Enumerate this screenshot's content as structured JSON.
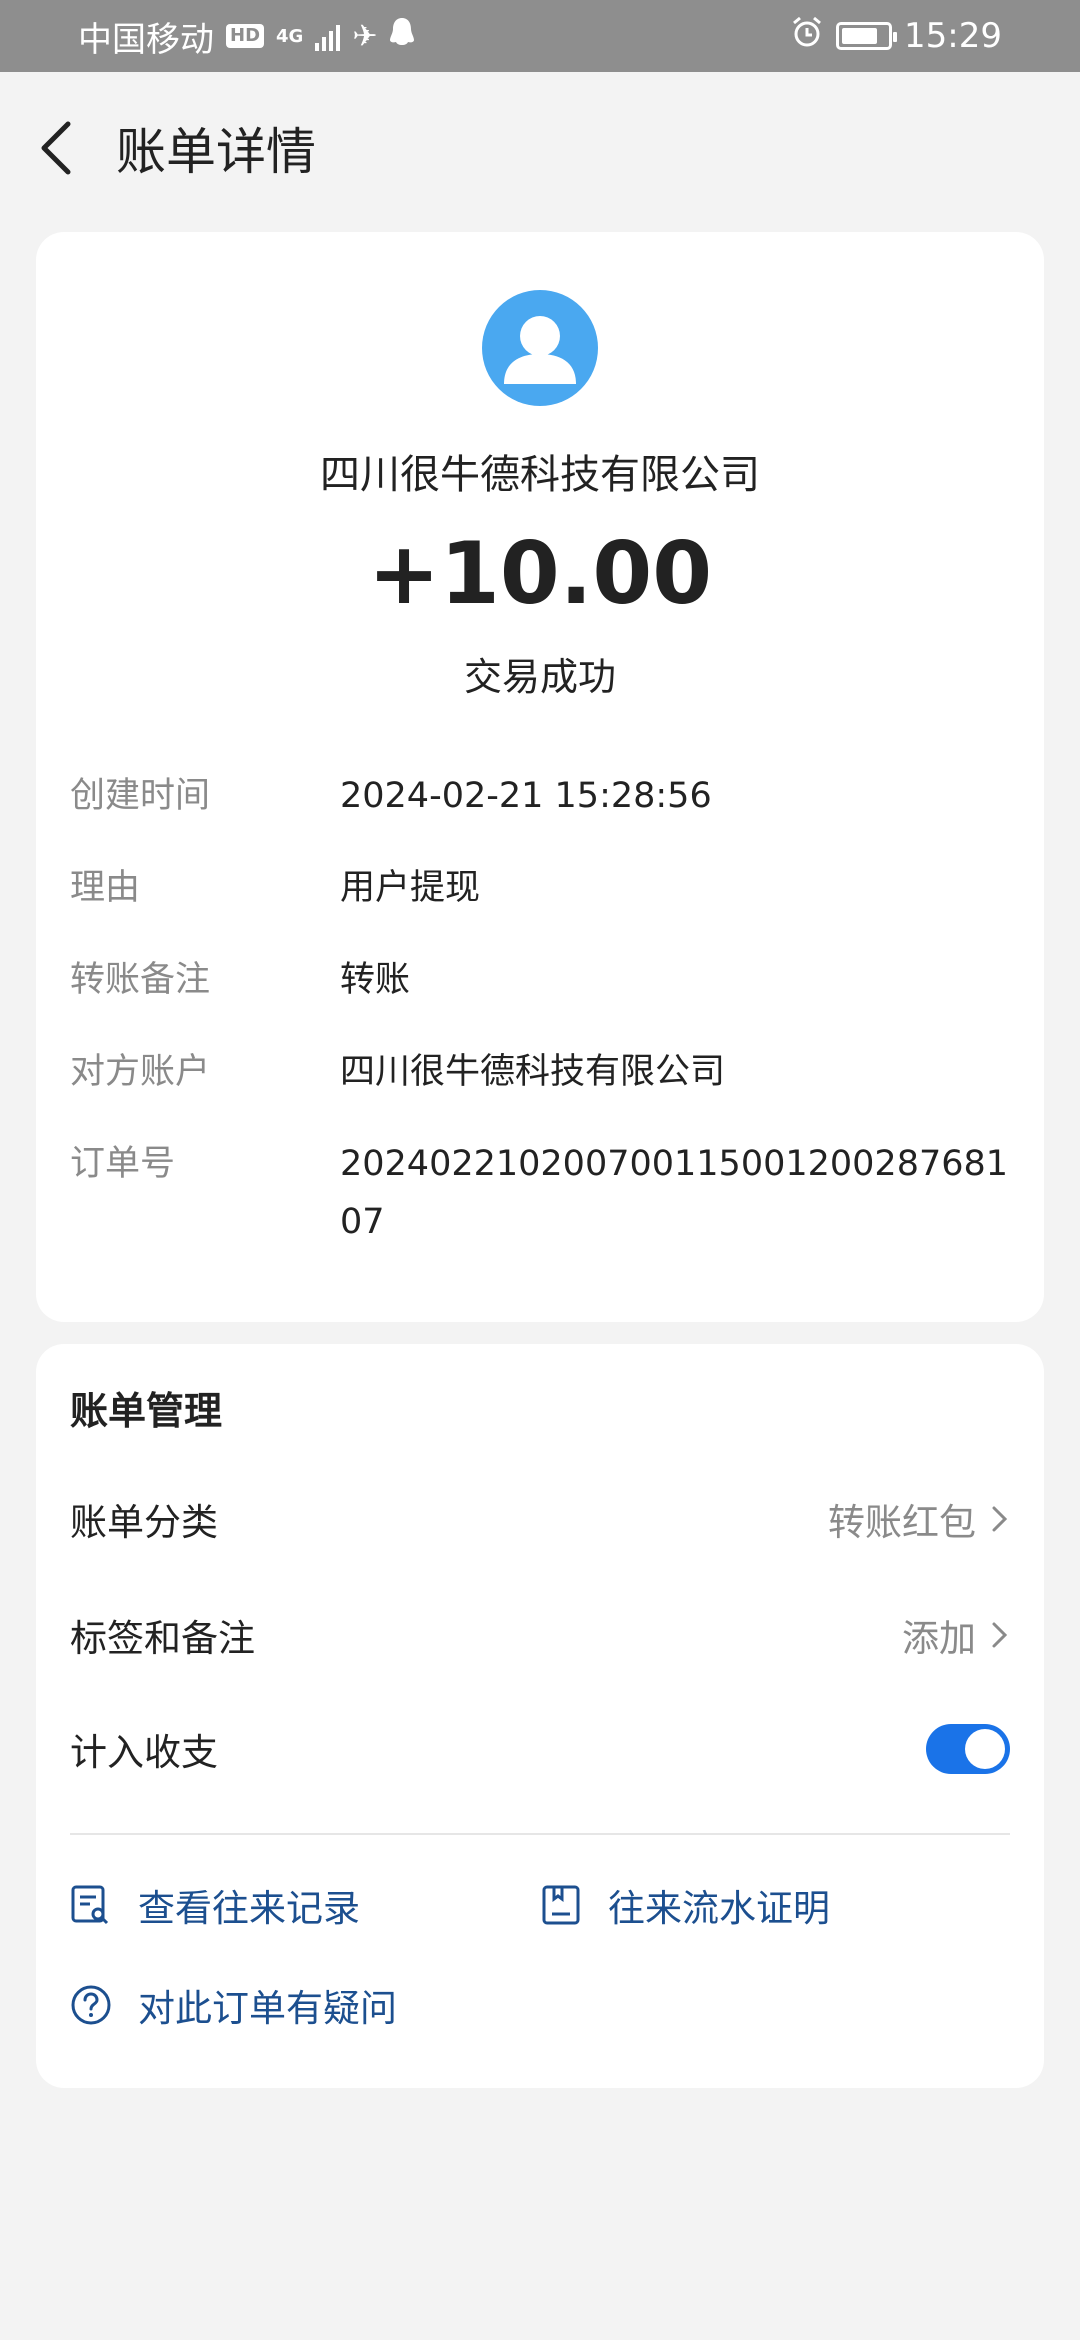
{
  "status_bar": {
    "carrier": "中国移动",
    "hd_badge": "HD",
    "network": "4G",
    "time": "15:29",
    "battery_level": 0.8
  },
  "header": {
    "title": "账单详情"
  },
  "transaction": {
    "payee": "四川很牛德科技有限公司",
    "amount": "+10.00",
    "status": "交易成功",
    "details": [
      {
        "label": "创建时间",
        "value": "2024-02-21 15:28:56"
      },
      {
        "label": "理由",
        "value": "用户提现"
      },
      {
        "label": "转账备注",
        "value": "转账"
      },
      {
        "label": "对方账户",
        "value": "四川很牛德科技有限公司"
      },
      {
        "label": "订单号",
        "value": "20240221020070011500120028768107"
      }
    ]
  },
  "management": {
    "title": "账单管理",
    "category_label": "账单分类",
    "category_value": "转账红包",
    "tags_label": "标签和备注",
    "tags_value": "添加",
    "include_label": "计入收支",
    "include_enabled": true,
    "links": {
      "view_records": "查看往来记录",
      "statement": "往来流水证明",
      "question": "对此订单有疑问"
    }
  },
  "colors": {
    "accent": "#1a73e8",
    "avatar": "#4aa8f0",
    "link": "#1c4f8f"
  }
}
